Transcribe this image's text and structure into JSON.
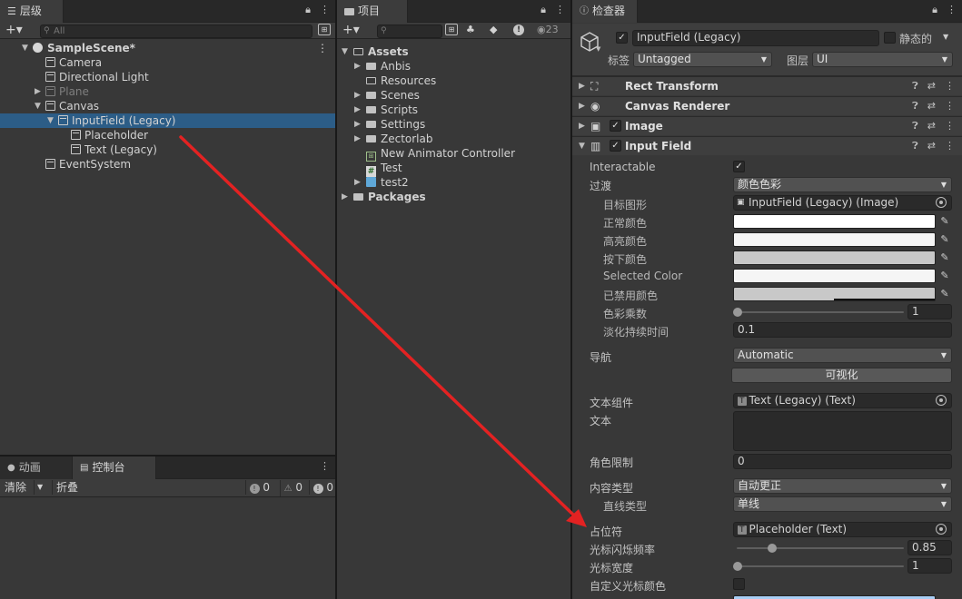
{
  "hierarchy": {
    "tab": "层级",
    "search_placeholder": "All",
    "rows": [
      {
        "label": "SampleScene*",
        "depth": 0,
        "kind": "scene",
        "arrow": "▼",
        "dim": false,
        "selected": false
      },
      {
        "label": "Camera",
        "depth": 1,
        "kind": "object",
        "arrow": "",
        "dim": false,
        "selected": false
      },
      {
        "label": "Directional Light",
        "depth": 1,
        "kind": "object",
        "arrow": "",
        "dim": false,
        "selected": false
      },
      {
        "label": "Plane",
        "depth": 1,
        "kind": "object",
        "arrow": "▶",
        "dim": true,
        "selected": false
      },
      {
        "label": "Canvas",
        "depth": 1,
        "kind": "object",
        "arrow": "▼",
        "dim": false,
        "selected": false
      },
      {
        "label": "InputField (Legacy)",
        "depth": 2,
        "kind": "object",
        "arrow": "▼",
        "dim": false,
        "selected": true
      },
      {
        "label": "Placeholder",
        "depth": 3,
        "kind": "object",
        "arrow": "",
        "dim": false,
        "selected": false
      },
      {
        "label": "Text (Legacy)",
        "depth": 3,
        "kind": "object",
        "arrow": "",
        "dim": false,
        "selected": false
      },
      {
        "label": "EventSystem",
        "depth": 1,
        "kind": "object",
        "arrow": "",
        "dim": false,
        "selected": false
      }
    ]
  },
  "project": {
    "tab": "项目",
    "count": "23",
    "rows": [
      {
        "label": "Assets",
        "depth": 0,
        "kind": "folder-open",
        "arrow": "▼",
        "bold": true
      },
      {
        "label": "Anbis",
        "depth": 1,
        "kind": "folder",
        "arrow": "▶",
        "bold": false
      },
      {
        "label": "Resources",
        "depth": 1,
        "kind": "folder-open",
        "arrow": "",
        "bold": false
      },
      {
        "label": "Scenes",
        "depth": 1,
        "kind": "folder",
        "arrow": "▶",
        "bold": false
      },
      {
        "label": "Scripts",
        "depth": 1,
        "kind": "folder",
        "arrow": "▶",
        "bold": false
      },
      {
        "label": "Settings",
        "depth": 1,
        "kind": "folder",
        "arrow": "▶",
        "bold": false
      },
      {
        "label": "Zectorlab",
        "depth": 1,
        "kind": "folder",
        "arrow": "▶",
        "bold": false
      },
      {
        "label": "New Animator Controller",
        "depth": 1,
        "kind": "animator",
        "arrow": "",
        "bold": false
      },
      {
        "label": "Test",
        "depth": 1,
        "kind": "script",
        "arrow": "",
        "bold": false
      },
      {
        "label": "test2",
        "depth": 1,
        "kind": "prefab",
        "arrow": "▶",
        "bold": false
      },
      {
        "label": "Packages",
        "depth": 0,
        "kind": "folder",
        "arrow": "▶",
        "bold": true
      }
    ]
  },
  "console": {
    "tab_animation": "动画",
    "tab_console": "控制台",
    "clear": "清除",
    "collapse": "折叠",
    "info_count": "0",
    "warn_count": "0",
    "error_count": "0"
  },
  "inspector": {
    "tab": "检查器",
    "object_name": "InputField (Legacy)",
    "static_label": "静态的",
    "tag_label": "标签",
    "tag_value": "Untagged",
    "layer_label": "图层",
    "layer_value": "UI",
    "components": [
      "Rect Transform",
      "Canvas Renderer",
      "Image",
      "Input Field"
    ],
    "interactable_label": "Interactable",
    "transition_label": "过渡",
    "transition_value": "颜色色彩",
    "target_graphic_label": "目标图形",
    "target_graphic_value": "InputField (Legacy) (Image)",
    "normal_color_label": "正常颜色",
    "highlighted_color_label": "高亮颜色",
    "pressed_color_label": "按下颜色",
    "selected_color_label": "Selected Color",
    "disabled_color_label": "已禁用颜色",
    "color_multiplier_label": "色彩乘数",
    "color_multiplier_value": "1",
    "fade_duration_label": "淡化持续时间",
    "fade_duration_value": "0.1",
    "navigation_label": "导航",
    "navigation_value": "Automatic",
    "visualize_label": "可视化",
    "text_component_label": "文本组件",
    "text_component_value": "Text (Legacy) (Text)",
    "text_label": "文本",
    "char_limit_label": "角色限制",
    "char_limit_value": "0",
    "content_type_label": "内容类型",
    "content_type_value": "自动更正",
    "line_type_label": "直线类型",
    "line_type_value": "单线",
    "placeholder_label": "占位符",
    "placeholder_value": "Placeholder (Text)",
    "caret_blink_label": "光标闪烁频率",
    "caret_blink_value": "0.85",
    "caret_width_label": "光标宽度",
    "caret_width_value": "1",
    "custom_caret_label": "自定义光标颜色",
    "colors": {
      "normal": "#ffffff",
      "highlighted": "#f5f5f5",
      "pressed": "#c8c8c8",
      "selected": "#f5f5f5",
      "disabled": "#c8c8c8",
      "selection": "#a8cef5"
    }
  },
  "annotation": {
    "color": "#e32222"
  }
}
